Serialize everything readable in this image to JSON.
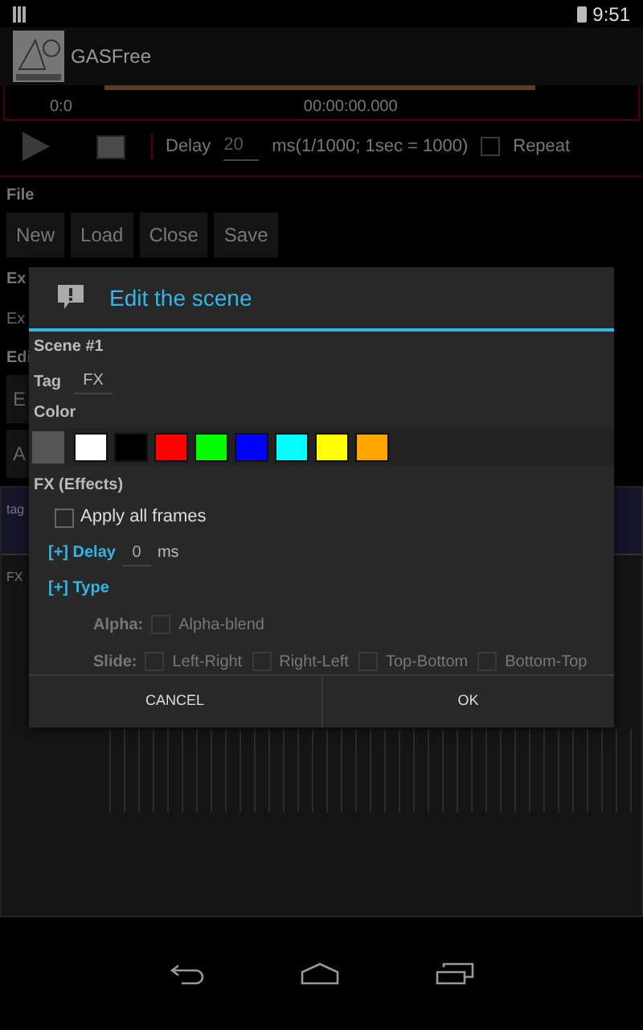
{
  "status_bar": {
    "time": "9:51"
  },
  "app": {
    "title": "GASFree"
  },
  "timeline": {
    "position": "0:0",
    "timecode": "00:00:00.000"
  },
  "playback": {
    "delay_label": "Delay",
    "delay_value": "20",
    "delay_hint": "ms(1/1000; 1sec = 1000)",
    "repeat": {
      "label": "Repeat",
      "checked": false
    }
  },
  "file": {
    "label": "File",
    "buttons": [
      "New",
      "Load",
      "Close",
      "Save"
    ]
  },
  "export": {
    "label": "Ex",
    "buttons": [
      "Ex"
    ]
  },
  "edit": {
    "label": "Edi",
    "buttons": [
      "E",
      "A"
    ]
  },
  "track": {
    "tag_label": "tag",
    "fx_label": "FX"
  },
  "dialog": {
    "title": "Edit the scene",
    "scene": "Scene #1",
    "tag_label": "Tag",
    "tag_value": "FX",
    "color_label": "Color",
    "current": {
      "color": "#555555"
    },
    "colors": [
      {
        "color": "#ffffff"
      },
      {
        "color": "#000000"
      },
      {
        "color": "#ff0000"
      },
      {
        "color": "#00ff00"
      },
      {
        "color": "#0000ff"
      },
      {
        "color": "#00ffff"
      },
      {
        "color": "#ffff00"
      },
      {
        "color": "#ffa500"
      }
    ],
    "fx_title": "FX (Effects)",
    "apply_all": {
      "label": "Apply all frames",
      "checked": false
    },
    "delay": {
      "label": "[+] Delay",
      "value": "0",
      "unit": "ms"
    },
    "type_label": "[+] Type",
    "type_groups": [
      {
        "label": "Alpha:",
        "disabled": true,
        "options": [
          {
            "label": "Alpha-blend",
            "checked": false
          }
        ]
      },
      {
        "label": "Slide:",
        "disabled": true,
        "options": [
          {
            "label": "Left-Right",
            "checked": false
          },
          {
            "label": "Right-Left",
            "checked": false
          },
          {
            "label": "Top-Bottom",
            "checked": false
          },
          {
            "label": "Bottom-Top",
            "checked": false
          }
        ]
      }
    ],
    "buttons": [
      "CANCEL",
      "OK"
    ]
  }
}
